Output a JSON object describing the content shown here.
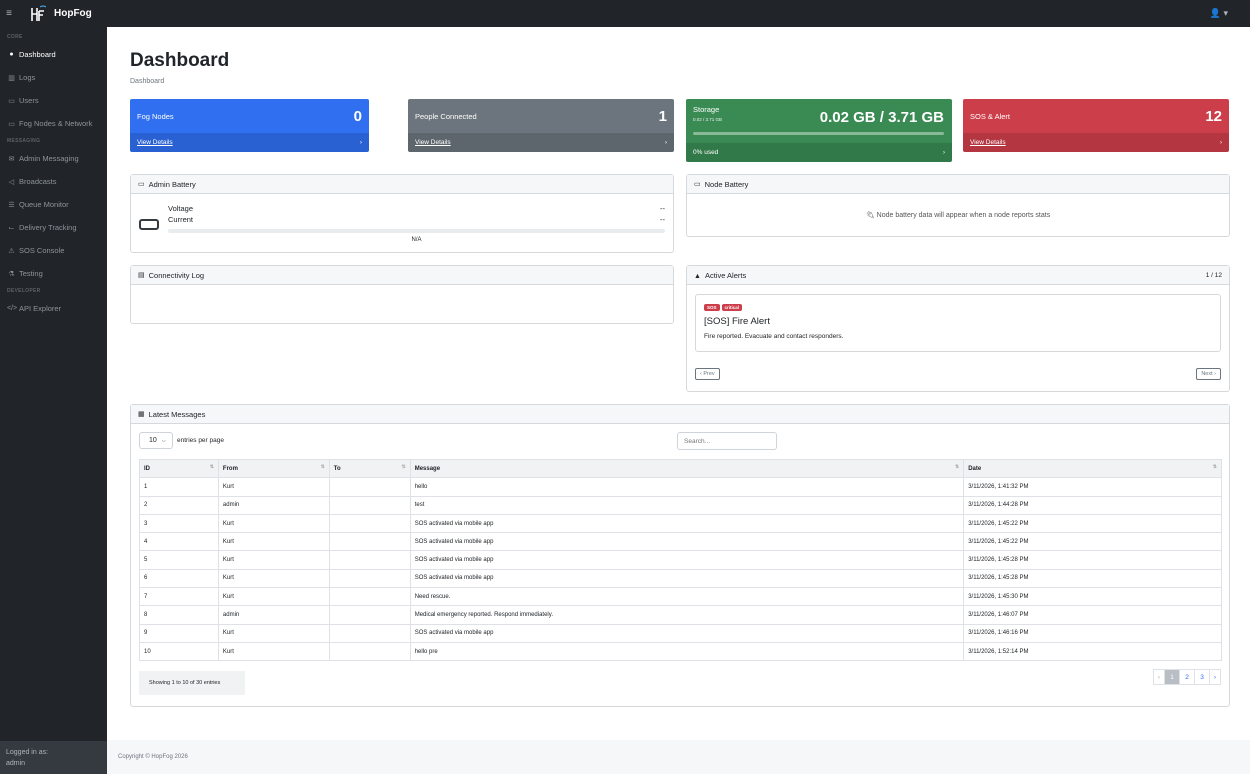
{
  "nav": {
    "brand": "HopFog",
    "menu_icon": "hamburger-icon",
    "user_icon": "user-icon"
  },
  "sidebar": {
    "sections": [
      {
        "heading": "CORE",
        "items": [
          {
            "label": "Dashboard",
            "icon": "gauge-icon",
            "active": true
          },
          {
            "label": "Logs",
            "icon": "chart-icon"
          },
          {
            "label": "Users",
            "icon": "users-icon"
          },
          {
            "label": "Fog Nodes & Network",
            "icon": "network-icon"
          }
        ]
      },
      {
        "heading": "MESSAGING",
        "items": [
          {
            "label": "Admin Messaging",
            "icon": "message-icon"
          },
          {
            "label": "Broadcasts",
            "icon": "megaphone-icon"
          },
          {
            "label": "Queue Monitor",
            "icon": "queue-icon"
          },
          {
            "label": "Delivery Tracking",
            "icon": "tracking-icon"
          },
          {
            "label": "SOS Console",
            "icon": "warning-icon"
          },
          {
            "label": "Testing",
            "icon": "flask-icon"
          }
        ]
      },
      {
        "heading": "DEVELOPER",
        "items": [
          {
            "label": "API Explorer",
            "icon": "code-icon"
          }
        ]
      }
    ],
    "footer_label": "Logged in as:",
    "footer_user": "admin"
  },
  "page": {
    "title": "Dashboard",
    "breadcrumb": "Dashboard"
  },
  "stats": {
    "fog_nodes": {
      "label": "Fog Nodes",
      "value": "0",
      "link": "View Details",
      "color": "#2f6ff0"
    },
    "people": {
      "label": "People Connected",
      "value": "1",
      "link": "View Details",
      "color": "#6c757d"
    },
    "storage": {
      "label": "Storage",
      "sub": "0.02 / 3.71 GB",
      "value": "0.02 GB / 3.71 GB",
      "used_text": "0% used",
      "used_fraction": 0.0,
      "color": "#3a8a54"
    },
    "sos": {
      "label": "SOS & Alert",
      "value": "12",
      "link": "View Details",
      "color": "#cc3e4a"
    }
  },
  "admin_battery": {
    "title": "Admin Battery",
    "voltage_label": "Voltage",
    "voltage_value": "--",
    "current_label": "Current",
    "current_value": "--",
    "level_text": "N/A"
  },
  "node_battery": {
    "title": "Node Battery",
    "message": "Node battery data will appear when a node reports stats"
  },
  "connectivity": {
    "title": "Connectivity Log"
  },
  "alerts": {
    "title": "Active Alerts",
    "counter": "1 / 12",
    "badges": [
      "SOS",
      "critical"
    ],
    "alert_title": "[SOS] Fire Alert",
    "alert_body": "Fire reported. Evacuate and contact responders.",
    "prev": "‹ Prev",
    "next": "Next ›"
  },
  "messages": {
    "title": "Latest Messages",
    "page_size": "10",
    "page_size_suffix": "entries per page",
    "search_placeholder": "Search...",
    "columns": [
      "ID",
      "From",
      "To",
      "Message",
      "Date"
    ],
    "rows": [
      [
        "1",
        "Kurt",
        "",
        "hello",
        "3/11/2026, 1:41:32 PM"
      ],
      [
        "2",
        "admin",
        "",
        "test",
        "3/11/2026, 1:44:28 PM"
      ],
      [
        "3",
        "Kurt",
        "",
        "SOS activated via mobile app",
        "3/11/2026, 1:45:22 PM"
      ],
      [
        "4",
        "Kurt",
        "",
        "SOS activated via mobile app",
        "3/11/2026, 1:45:22 PM"
      ],
      [
        "5",
        "Kurt",
        "",
        "SOS activated via mobile app",
        "3/11/2026, 1:45:28 PM"
      ],
      [
        "6",
        "Kurt",
        "",
        "SOS activated via mobile app",
        "3/11/2026, 1:45:28 PM"
      ],
      [
        "7",
        "Kurt",
        "",
        "Need rescue.",
        "3/11/2026, 1:45:30 PM"
      ],
      [
        "8",
        "admin",
        "",
        "Medical emergency reported. Respond immediately.",
        "3/11/2026, 1:46:07 PM"
      ],
      [
        "9",
        "Kurt",
        "",
        "SOS activated via mobile app",
        "3/11/2026, 1:46:16 PM"
      ],
      [
        "10",
        "Kurt",
        "",
        "hello pre",
        "3/11/2026, 1:52:14 PM"
      ]
    ],
    "info": "Showing 1 to 10 of 30 entries",
    "pages": [
      "‹",
      "1",
      "2",
      "3",
      "›"
    ]
  },
  "footer": {
    "copyright": "Copyright © HopFog 2026"
  }
}
